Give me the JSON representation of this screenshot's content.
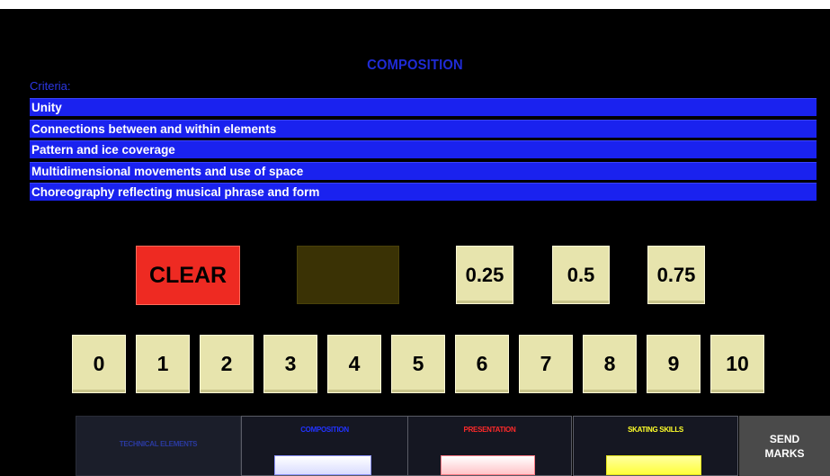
{
  "title": "COMPOSITION",
  "criteria_label": "Criteria:",
  "criteria": [
    "Unity",
    "Connections between and within elements",
    "Pattern and ice coverage",
    "Multidimensional movements and use of space",
    "Choreography reflecting musical phrase and form"
  ],
  "buttons": {
    "clear": "CLEAR",
    "fractions": [
      "0.25",
      "0.5",
      "0.75"
    ],
    "digits": [
      "0",
      "1",
      "2",
      "3",
      "4",
      "5",
      "6",
      "7",
      "8",
      "9",
      "10"
    ]
  },
  "tabs": {
    "technical": "TECHNICAL ELEMENTS",
    "composition": "COMPOSITION",
    "presentation": "PRESENTATION",
    "skating": "SKATING SKILLS"
  },
  "send": {
    "line1": "SEND",
    "line2": "MARKS"
  },
  "colors": {
    "criteria_bg": "#1a22ef",
    "clear_bg": "#ee2a22",
    "key_bg": "#e7e4ad",
    "composition_accent": "#2233ff",
    "presentation_accent": "#ff2a2a",
    "skating_accent": "#ffff2a"
  }
}
